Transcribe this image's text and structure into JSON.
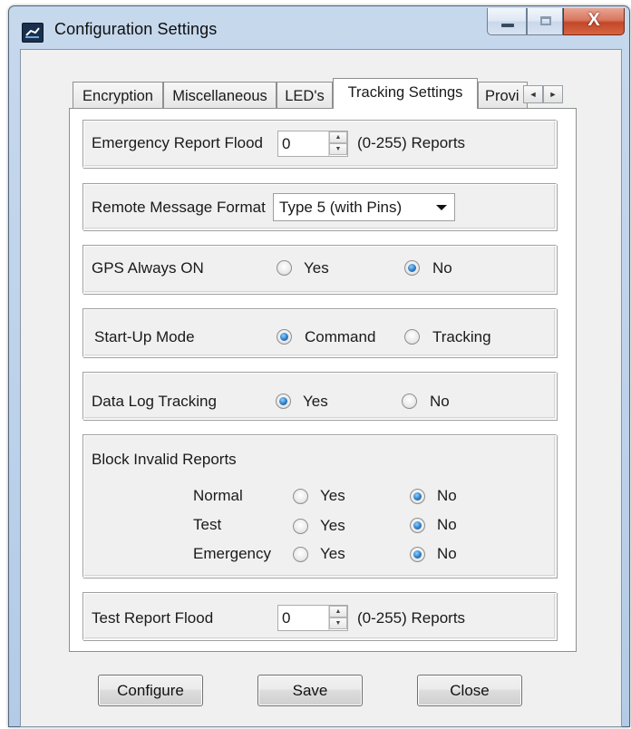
{
  "window": {
    "title": "Configuration Settings"
  },
  "caption": {
    "close_glyph": "X"
  },
  "tabs": [
    {
      "label": "Encryption"
    },
    {
      "label": "Miscellaneous"
    },
    {
      "label": "LED's"
    },
    {
      "label": "Tracking Settings",
      "active": true
    },
    {
      "label": "Provi"
    }
  ],
  "tab_scroll": {
    "left": "◄",
    "right": "►"
  },
  "emergency_flood": {
    "label": "Emergency Report Flood",
    "value": "0",
    "suffix": "(0-255) Reports"
  },
  "remote_format": {
    "label": "Remote Message Format",
    "value": "Type 5 (with Pins)"
  },
  "gps_always_on": {
    "label": "GPS Always ON",
    "opt_yes": "Yes",
    "opt_no": "No",
    "selected": "No"
  },
  "startup_mode": {
    "label": "Start-Up Mode",
    "opt_command": "Command",
    "opt_tracking": "Tracking",
    "selected": "Command"
  },
  "data_log": {
    "label": "Data Log Tracking",
    "opt_yes": "Yes",
    "opt_no": "No",
    "selected": "Yes"
  },
  "block_invalid": {
    "label": "Block Invalid Reports",
    "rows": [
      {
        "label": "Normal",
        "yes": "Yes",
        "no": "No",
        "selected": "No"
      },
      {
        "label": "Test",
        "yes": "Yes",
        "no": "No",
        "selected": "No"
      },
      {
        "label": "Emergency",
        "yes": "Yes",
        "no": "No",
        "selected": "No"
      }
    ]
  },
  "test_flood": {
    "label": "Test Report Flood",
    "value": "0",
    "suffix": "(0-255) Reports"
  },
  "buttons": {
    "configure": "Configure",
    "save": "Save",
    "close": "Close"
  },
  "colors": {
    "title_bar": "#bcd1ea",
    "close_button": "#c2472a",
    "radio_dot": "#2c7cc4"
  }
}
